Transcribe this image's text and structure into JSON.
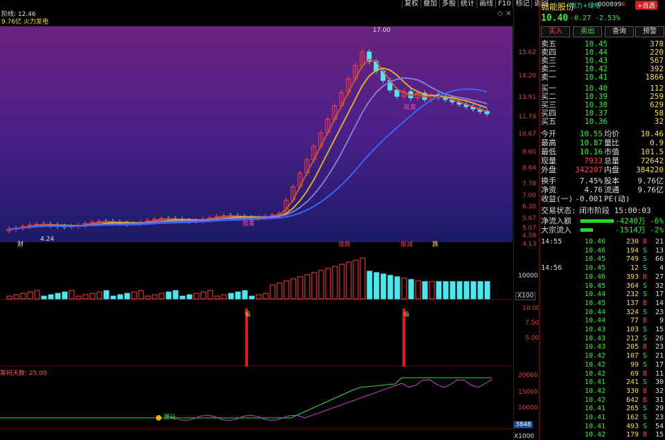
{
  "toolbar": [
    "复权",
    "叠加",
    "多股",
    "统计",
    "画线",
    "F10",
    "标记",
    "返回"
  ],
  "main_chart": {
    "indicator_label": "阶线: 12.46",
    "info_line": "9.76亿 火力发电",
    "high_label": "17.00",
    "low_label": "4.24",
    "price_axis": [
      "15.62",
      "14.20",
      "13.91",
      "11.74",
      "10.67",
      "9.60",
      "8.64",
      "7.78",
      "7.00",
      "6.30",
      "5.67",
      "5.07",
      "4.58",
      "4.13"
    ],
    "markers": [
      "财",
      "涨跌",
      "张减",
      "跌"
    ],
    "signal_texts": [
      "吸筹",
      "吸筹"
    ],
    "colors": {
      "bg_top": "#5e1e74",
      "bg_bottom": "#1a1660",
      "up": "#ff4040",
      "down": "#50e6f0"
    }
  },
  "volume_panel": {
    "axis_label": "10000",
    "unit": "X100"
  },
  "signal_panel": {
    "axis": [
      "10.00",
      "7.50",
      "5.00"
    ],
    "bar_label": "吸"
  },
  "bottom_panel": {
    "label": "筹码天数: 25.00",
    "axis": [
      "20000",
      "15000",
      "10000"
    ],
    "current_value": "3848",
    "unit": "X1000",
    "annotation": "黑马"
  },
  "quote": {
    "stock_name": "赣能股份",
    "tag": "电力+绿电",
    "code": "000899",
    "r": "R",
    "self_select": "+自选",
    "price": "10.40",
    "change": "-0.27",
    "change_pct": "-2.53%",
    "buttons": [
      "买入",
      "卖出",
      "查询",
      "预警"
    ],
    "asks": [
      {
        "label": "卖五",
        "price": "10.45",
        "vol": "378"
      },
      {
        "label": "卖四",
        "price": "10.44",
        "vol": "220"
      },
      {
        "label": "卖三",
        "price": "10.43",
        "vol": "567"
      },
      {
        "label": "卖二",
        "price": "10.42",
        "vol": "392"
      },
      {
        "label": "卖一",
        "price": "10.41",
        "vol": "1866"
      }
    ],
    "bids": [
      {
        "label": "买一",
        "price": "10.40",
        "vol": "112"
      },
      {
        "label": "买二",
        "price": "10.39",
        "vol": "259"
      },
      {
        "label": "买三",
        "price": "10.38",
        "vol": "629"
      },
      {
        "label": "买四",
        "price": "10.37",
        "vol": "58"
      },
      {
        "label": "买五",
        "price": "10.36",
        "vol": "32"
      }
    ],
    "stats1": [
      {
        "l1": "今开",
        "v1": "10.55",
        "l2": "均价",
        "v2": "10.46"
      },
      {
        "l1": "最高",
        "v1": "10.87",
        "l2": "量比",
        "v2": "0.9"
      },
      {
        "l1": "最低",
        "v1": "10.16",
        "l2": "市值",
        "v2": "101.5"
      },
      {
        "l1": "现量",
        "v1": "7933",
        "l2": "总量",
        "v2": "72642"
      },
      {
        "l1": "外盘",
        "v1": "342207",
        "l2": "内盘",
        "v2": "384220"
      }
    ],
    "stats2": [
      {
        "l1": "换手",
        "v1": "7.45%",
        "l2": "股本",
        "v2": "9.76亿"
      },
      {
        "l1": "净资",
        "v1": "4.76",
        "l2": "流通",
        "v2": "9.76亿"
      },
      {
        "l1": "收益(一)",
        "v1": "-0.001",
        "l2": "PE(动)",
        "v2": ""
      }
    ],
    "trade_status_label": "交易状态:",
    "trade_status": "闭市阶段 15:00:03",
    "flows": [
      {
        "label": "净流入额",
        "value": "-4240万",
        "pct": "-6%"
      },
      {
        "label": "大宗流入",
        "value": "-1514万",
        "pct": "-2%"
      }
    ]
  },
  "trades": [
    {
      "time": "14:55",
      "price": "10.46",
      "vol": "230",
      "side": "B",
      "n": "21"
    },
    {
      "time": "",
      "price": "10.46",
      "vol": "194",
      "side": "S",
      "n": "13"
    },
    {
      "time": "",
      "price": "10.45",
      "vol": "749",
      "side": "S",
      "n": "66"
    },
    {
      "time": "14:56",
      "price": "10.45",
      "vol": "12",
      "side": "S",
      "n": "4"
    },
    {
      "time": "",
      "price": "10.46",
      "vol": "393",
      "side": "B",
      "n": "27"
    },
    {
      "time": "",
      "price": "10.45",
      "vol": "364",
      "side": "S",
      "n": "32"
    },
    {
      "time": "",
      "price": "10.44",
      "vol": "232",
      "side": "S",
      "n": "17"
    },
    {
      "time": "",
      "price": "10.45",
      "vol": "137",
      "side": "B",
      "n": "14"
    },
    {
      "time": "",
      "price": "10.44",
      "vol": "324",
      "side": "S",
      "n": "23"
    },
    {
      "time": "",
      "price": "10.44",
      "vol": "77",
      "side": "B",
      "n": "9"
    },
    {
      "time": "",
      "price": "10.43",
      "vol": "103",
      "side": "S",
      "n": "15"
    },
    {
      "time": "",
      "price": "10.43",
      "vol": "212",
      "side": "S",
      "n": "26"
    },
    {
      "time": "",
      "price": "10.43",
      "vol": "205",
      "side": "B",
      "n": "23"
    },
    {
      "time": "",
      "price": "10.42",
      "vol": "107",
      "side": "S",
      "n": "21"
    },
    {
      "time": "",
      "price": "10.42",
      "vol": "99",
      "side": "S",
      "n": "17"
    },
    {
      "time": "",
      "price": "10.42",
      "vol": "69",
      "side": "B",
      "n": "11"
    },
    {
      "time": "",
      "price": "10.41",
      "vol": "241",
      "side": "S",
      "n": "30"
    },
    {
      "time": "",
      "price": "10.42",
      "vol": "330",
      "side": "B",
      "n": "32"
    },
    {
      "time": "",
      "price": "10.42",
      "vol": "642",
      "side": "B",
      "n": "31"
    },
    {
      "time": "",
      "price": "10.41",
      "vol": "265",
      "side": "S",
      "n": "29"
    },
    {
      "time": "",
      "price": "10.41",
      "vol": "162",
      "side": "S",
      "n": "23"
    },
    {
      "time": "",
      "price": "10.41",
      "vol": "493",
      "side": "S",
      "n": "54"
    },
    {
      "time": "",
      "price": "10.42",
      "vol": "179",
      "side": "B",
      "n": "15"
    }
  ]
}
